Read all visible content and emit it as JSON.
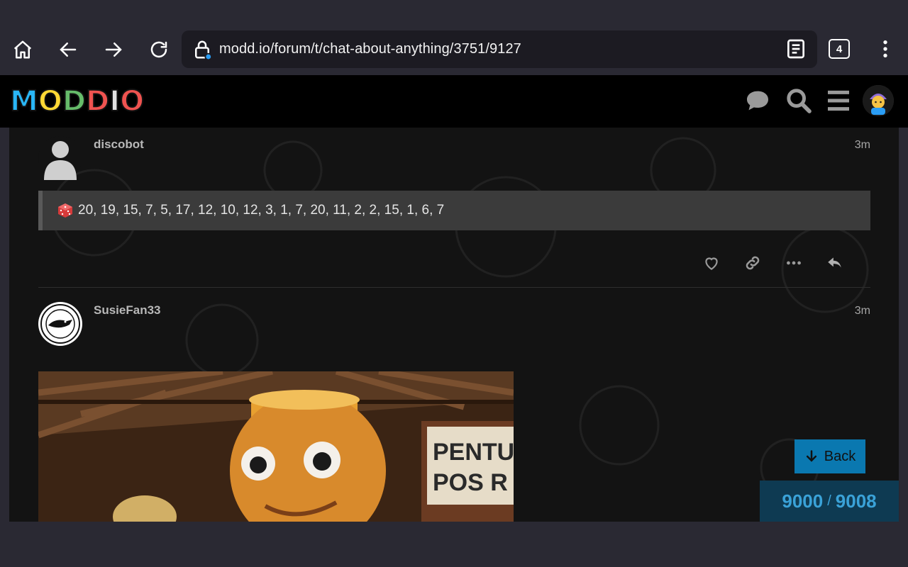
{
  "browser": {
    "url": "modd.io/forum/t/chat-about-anything/3751/9127",
    "tab_count": "4",
    "icons": [
      "home-icon",
      "back-arrow-icon",
      "forward-arrow-icon",
      "reload-icon",
      "lock-icon",
      "reader-mode-icon",
      "tabs-icon",
      "overflow-menu-icon"
    ]
  },
  "site": {
    "logo_letters": [
      "M",
      "O",
      "D",
      "D",
      "I",
      "O"
    ],
    "logo_colors": [
      "#29b6f6",
      "#fdd835",
      "#66bb6a",
      "#ef5350",
      "#e0e0e0",
      "#ef5350"
    ],
    "header_icons": [
      "chat-icon",
      "search-icon",
      "hamburger-icon",
      "user-avatar"
    ]
  },
  "posts": [
    {
      "username": "discobot",
      "time": "3m",
      "quote_text": "20, 19, 15, 7, 5, 17, 12, 10, 12, 3, 1, 7, 20, 11, 2, 2, 15, 1, 6, 7"
    },
    {
      "username": "SusieFan33",
      "time": "3m",
      "image_sign": [
        "PENTU",
        "POS R"
      ]
    }
  ],
  "timeline": {
    "back_label": "Back",
    "current": "9000",
    "separator": "/",
    "total": "9008"
  },
  "colors": {
    "accent": "#0a78b0",
    "progress_bg": "#0e3a52",
    "progress_text": "#3aa2d8"
  }
}
